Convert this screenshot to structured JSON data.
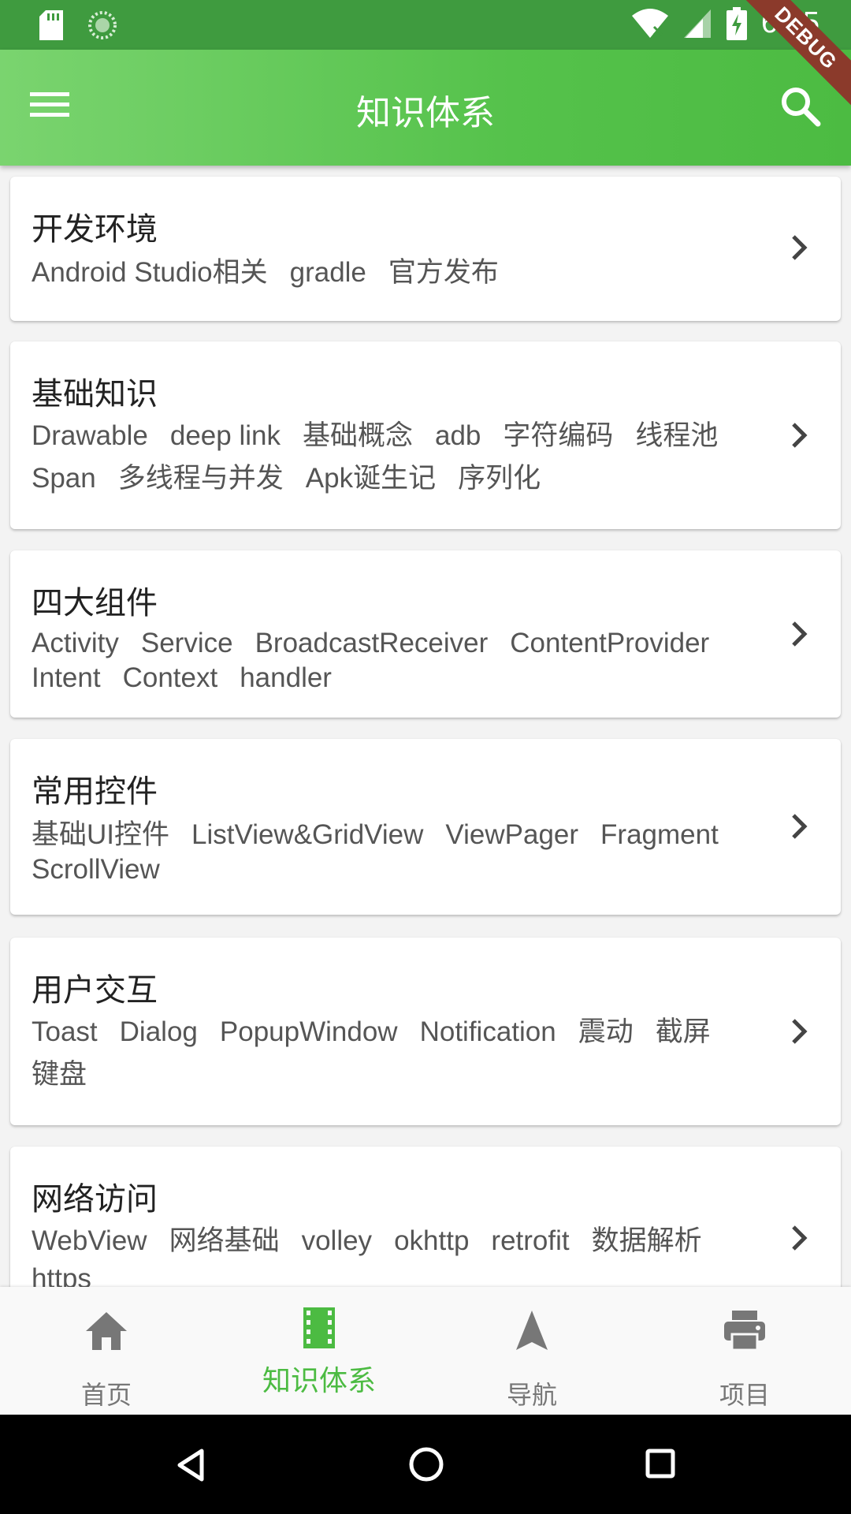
{
  "status_bar": {
    "time": "6:25",
    "icons": [
      "sd-card-icon",
      "sync-icon",
      "wifi-icon",
      "signal-icon",
      "battery-charging-icon"
    ]
  },
  "debug_banner": "DEBUG",
  "app_bar": {
    "title": "知识体系",
    "menu_icon": "menu-icon",
    "search_icon": "search-icon"
  },
  "colors": {
    "primary": "#55c24b",
    "status_bar": "#3f9b3f",
    "active_nav": "#4cbb42",
    "inactive_nav": "#777777"
  },
  "categories": [
    {
      "title": "开发环境",
      "tags": [
        "Android Studio相关",
        "gradle",
        "官方发布"
      ]
    },
    {
      "title": "基础知识",
      "tags": [
        "Drawable",
        "deep link",
        "基础概念",
        "adb",
        "字符编码",
        "线程池",
        "Span",
        "多线程与并发",
        "Apk诞生记",
        "序列化"
      ]
    },
    {
      "title": "四大组件",
      "tags": [
        "Activity",
        "Service",
        "BroadcastReceiver",
        "ContentProvider",
        "Intent",
        "Context",
        "handler"
      ]
    },
    {
      "title": "常用控件",
      "tags": [
        "基础UI控件",
        "ListView&GridView",
        "ViewPager",
        "Fragment",
        "ScrollView"
      ]
    },
    {
      "title": "用户交互",
      "tags": [
        "Toast",
        "Dialog",
        "PopupWindow",
        "Notification",
        "震动",
        "截屏",
        "键盘"
      ]
    },
    {
      "title": "网络访问",
      "tags": [
        "WebView",
        "网络基础",
        "volley",
        "okhttp",
        "retrofit",
        "数据解析",
        "https"
      ]
    }
  ],
  "bottom_nav": {
    "items": [
      {
        "label": "首页",
        "icon": "home-icon",
        "active": false
      },
      {
        "label": "知识体系",
        "icon": "film-icon",
        "active": true
      },
      {
        "label": "导航",
        "icon": "navigation-icon",
        "active": false
      },
      {
        "label": "项目",
        "icon": "print-icon",
        "active": false
      }
    ]
  },
  "system_nav": [
    "back-icon",
    "home-circle-icon",
    "recents-icon"
  ]
}
